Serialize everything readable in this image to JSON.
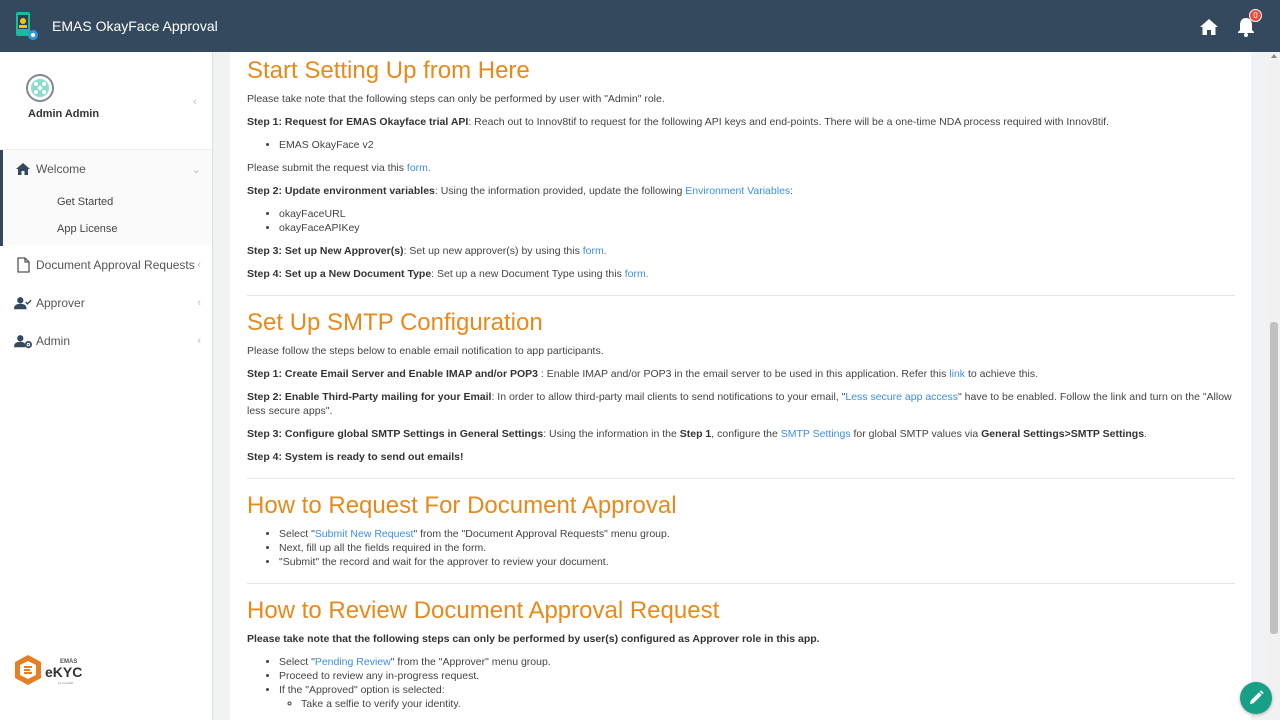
{
  "app": {
    "title": "EMAS OkayFace Approval",
    "notification_count": "0"
  },
  "sidebar": {
    "user_name": "Admin Admin",
    "welcome": {
      "label": "Welcome",
      "items": [
        "Get Started",
        "App License"
      ]
    },
    "items": [
      {
        "label": "Document Approval Requests",
        "icon": "document-icon"
      },
      {
        "label": "Approver",
        "icon": "user-check-icon"
      },
      {
        "label": "Admin",
        "icon": "user-gear-icon"
      }
    ],
    "logo": {
      "top": "EMAS",
      "main": "eKYC",
      "sub": "by innov8tif"
    }
  },
  "sections": {
    "setup": {
      "title": "Start Setting Up from Here",
      "note": "Please take note that the following steps can only be performed by user with \"Admin\" role.",
      "step1_label": "Step 1: Request for EMAS Okayface trial API",
      "step1_text": ": Reach out to Innov8tif to request for the following API keys and end-points. There will be a one-time NDA process required with Innov8tif.",
      "step1_items": [
        "EMAS OkayFace v2"
      ],
      "submit_pre": "Please submit the request via this ",
      "submit_link": "form.",
      "step2_label": "Step 2: Update environment variables",
      "step2_text": ": Using the information provided, update the following ",
      "step2_link": "Environment Variables",
      "step2_end": ":",
      "step2_items": [
        "okayFaceURL",
        "okayFaceAPIKey"
      ],
      "step3_label": "Step 3: Set up New Approver(s)",
      "step3_text": ": Set up new approver(s) by using this ",
      "step3_link": "form.",
      "step4_label": "Step 4: Set up a New Document Type",
      "step4_text": ": Set up a new Document Type using this ",
      "step4_link": "form."
    },
    "smtp": {
      "title": "Set Up SMTP Configuration",
      "intro": "Please follow the steps below to enable email notification to app participants.",
      "step1_label": "Step 1: Create Email Server and Enable IMAP and/or POP3",
      "step1_text": " : Enable IMAP and/or POP3 in the email server to be used in this application. Refer this ",
      "step1_link": "link",
      "step1_end": " to achieve this.",
      "step2_label": "Step 2: Enable Third-Party mailing for your Email",
      "step2_text": ": In order to allow third-party mail clients to send notifications to your email, \"",
      "step2_link": "Less secure app access",
      "step2_end": "\" have to be enabled. Follow the link and turn on the \"Allow less secure apps\".",
      "step3_label": "Step 3: Configure global SMTP Settings in General Settings",
      "step3_text_a": ": Using the information in the ",
      "step3_bold": "Step 1",
      "step3_text_b": ", configure the ",
      "step3_link": "SMTP Settings",
      "step3_text_c": " for global SMTP values via ",
      "step3_bold2": "General Settings>SMTP Settings",
      "step3_end": ".",
      "step4_label": "Step 4: System is ready to send out emails!"
    },
    "request": {
      "title": "How to Request For Document Approval",
      "item1_pre": "Select \"",
      "item1_link": "Submit New Request",
      "item1_post": "\" from the \"Document Approval Requests\" menu group.",
      "item2": "Next, fill up all the fields required in the form.",
      "item3": "\"Submit\" the record and wait for the approver to review your document."
    },
    "review": {
      "title": "How to Review Document Approval Request",
      "note": "Please take note that the following steps can only be performed by user(s) configured as Approver role in this app.",
      "item1_pre": "Select \"",
      "item1_link": "Pending Review",
      "item1_post": "\" from the \"Approver\" menu group.",
      "item2": "Proceed to review any in-progress request.",
      "item3": "If the \"Approved\" option is selected:",
      "sub1": "Take a selfie to verify your identity."
    }
  },
  "colors": {
    "topbar": "#34495e",
    "heading": "#e68a1d",
    "link": "#3d8ee0",
    "fab": "#16a085",
    "badge": "#e74c3c"
  }
}
